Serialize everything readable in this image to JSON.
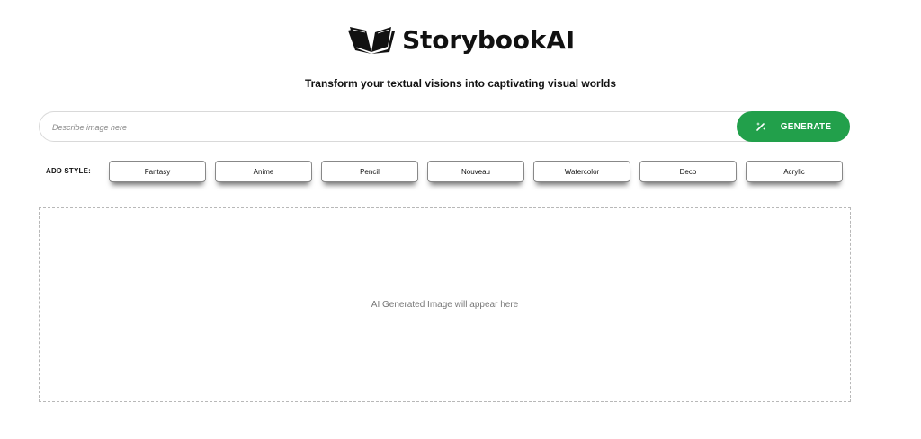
{
  "header": {
    "logo_icon": "open-book-icon",
    "title": "StorybookAI",
    "tagline": "Transform your textual visions into captivating visual worlds"
  },
  "search": {
    "placeholder": "Describe image here",
    "value": ""
  },
  "generate_button": {
    "label": "GENERATE",
    "icon": "magic-wand-icon",
    "color": "#22a04b"
  },
  "styles": {
    "label": "ADD STYLE:",
    "options": [
      "Fantasy",
      "Anime",
      "Pencil",
      "Nouveau",
      "Watercolor",
      "Deco",
      "Acrylic"
    ]
  },
  "preview": {
    "placeholder_text": "AI Generated Image will appear here"
  }
}
